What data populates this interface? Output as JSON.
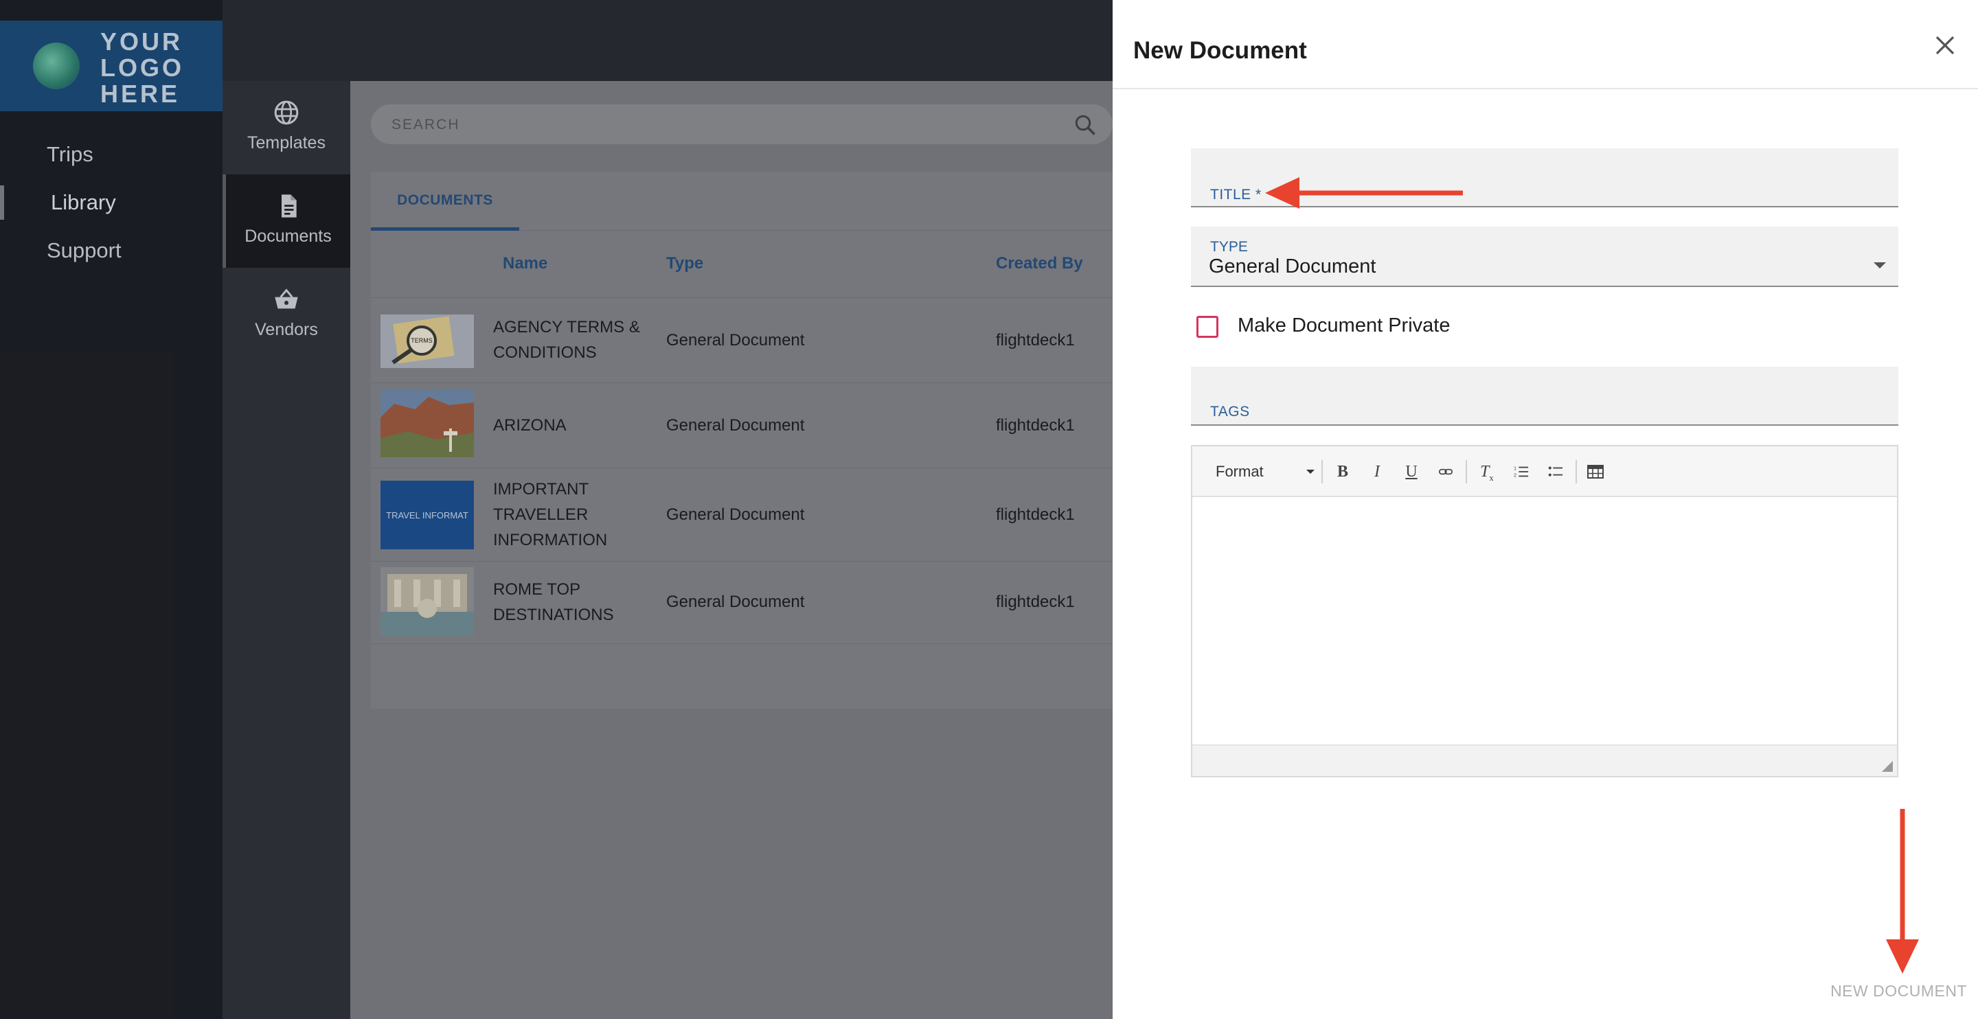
{
  "logo": {
    "lines": [
      "YOUR",
      "LOGO",
      "HERE"
    ]
  },
  "nav": {
    "items": [
      {
        "label": "Trips"
      },
      {
        "label": "Library"
      },
      {
        "label": "Support"
      }
    ]
  },
  "rail": {
    "items": [
      {
        "label": "Templates",
        "icon": "globe-icon"
      },
      {
        "label": "Documents",
        "icon": "document-icon"
      },
      {
        "label": "Vendors",
        "icon": "basket-icon"
      }
    ]
  },
  "search": {
    "placeholder": "SEARCH"
  },
  "tabs": [
    {
      "label": "DOCUMENTS"
    }
  ],
  "table": {
    "headers": [
      "Name",
      "Type",
      "Created By"
    ],
    "rows": [
      {
        "name": "AGENCY TERMS & CONDITIONS",
        "name_lines": [
          "AGENCY TERMS &",
          "CONDITIONS"
        ],
        "type": "General Document",
        "created_by": "flightdeck1",
        "thumb_text": "TERMS"
      },
      {
        "name": "ARIZONA",
        "name_lines": [
          "ARIZONA"
        ],
        "type": "General Document",
        "created_by": "flightdeck1",
        "thumb_text": ""
      },
      {
        "name": "IMPORTANT TRAVELLER INFORMATION",
        "name_lines": [
          "IMPORTANT",
          "TRAVELLER",
          "INFORMATION"
        ],
        "type": "General Document",
        "created_by": "flightdeck1",
        "thumb_text": "TRAVEL INFORMAT"
      },
      {
        "name": "ROME TOP DESTINATIONS",
        "name_lines": [
          "ROME TOP",
          "DESTINATIONS"
        ],
        "type": "General Document",
        "created_by": "flightdeck1",
        "thumb_text": ""
      }
    ]
  },
  "drawer": {
    "title": "New Document",
    "fields": {
      "title_label": "TITLE *",
      "title_value": "",
      "type_label": "TYPE",
      "type_value": "General Document",
      "private_label": "Make Document Private",
      "private_checked": false,
      "tags_label": "TAGS"
    },
    "editor": {
      "format_label": "Format",
      "tools": [
        "bold-icon",
        "italic-icon",
        "underline-icon",
        "link-icon",
        "clear-format-icon",
        "ordered-list-icon",
        "bullet-list-icon",
        "table-icon"
      ],
      "content": ""
    },
    "submit_label": "NEW DOCUMENT"
  },
  "colors": {
    "accent": "#264f7e",
    "annotation_arrow": "#e8432e",
    "checkbox_border": "#d6355a",
    "logo_bg": "#1c4a78"
  }
}
